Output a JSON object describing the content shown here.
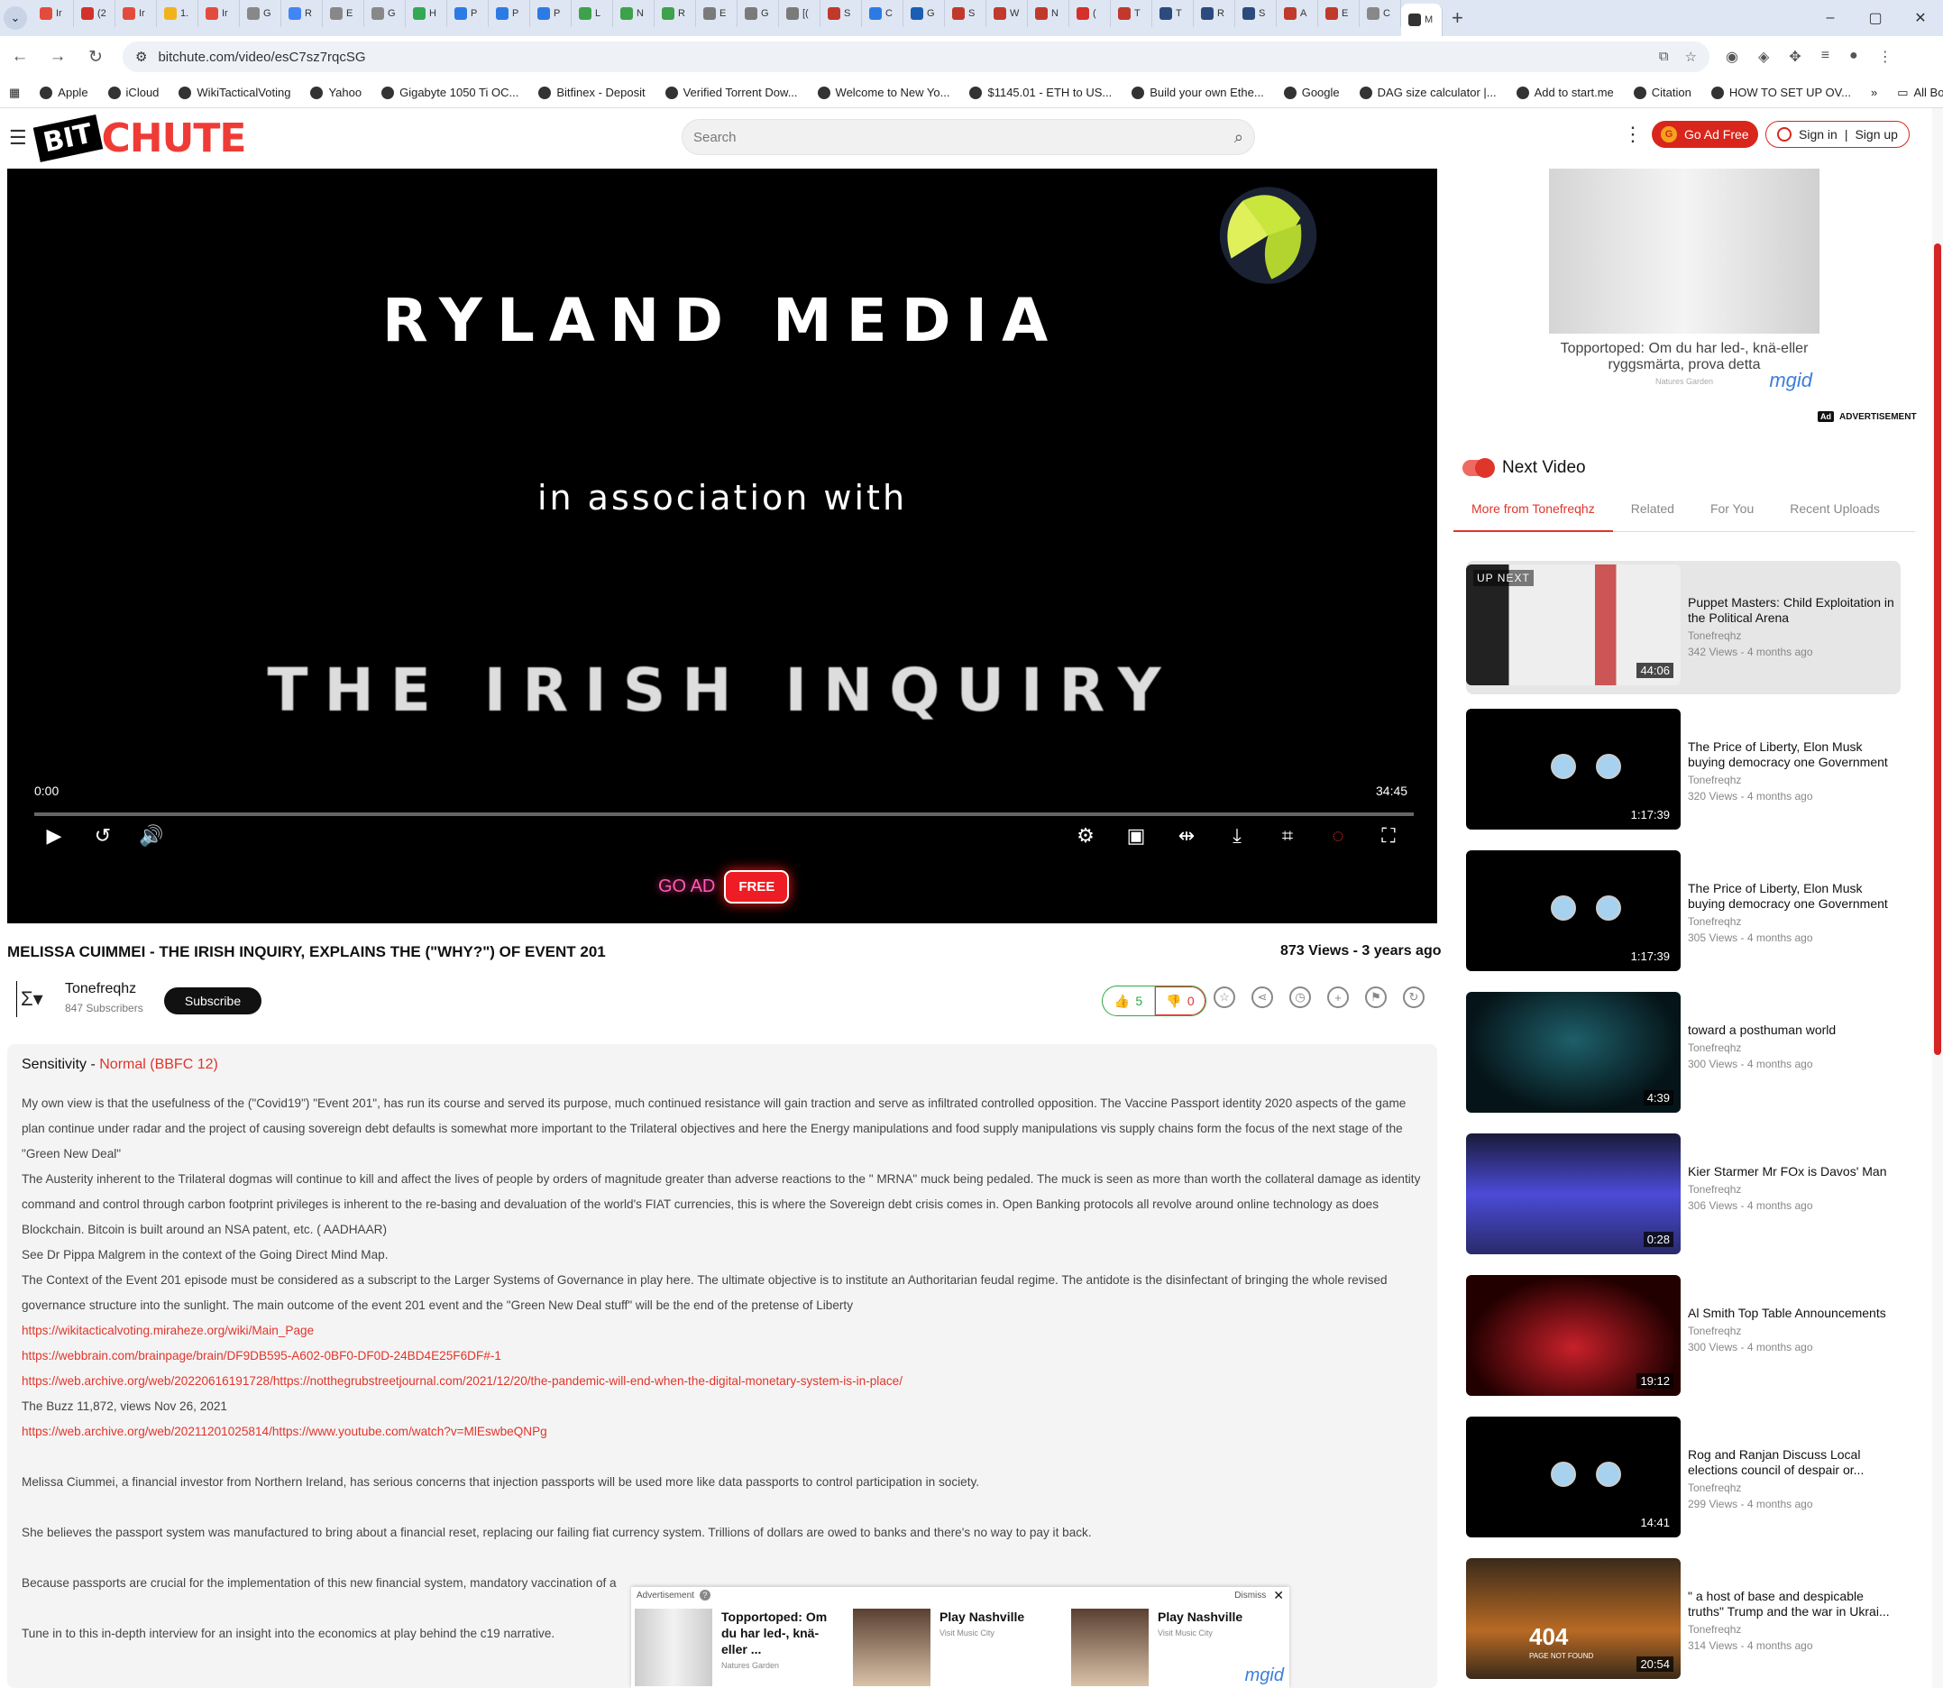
{
  "browser": {
    "tabs": [
      "Ir",
      "(2",
      "Ir",
      "1.",
      "Ir",
      "G",
      "R",
      "E",
      "G",
      "H",
      "P",
      "P",
      "P",
      "L",
      "N",
      "R",
      "E",
      "G",
      "[(",
      "S",
      "C",
      "G",
      "S",
      "W",
      "N",
      "(",
      "T",
      "T",
      "R",
      "S",
      "A",
      "E",
      "C",
      "M"
    ],
    "active_tab_index": 33,
    "url": "bitchute.com/video/esC7sz7rqcSG",
    "bookmarks": [
      "Apple",
      "iCloud",
      "WikiTacticalVoting",
      "Yahoo",
      "Gigabyte 1050 Ti OC...",
      "Bitfinex - Deposit",
      "Verified Torrent Dow...",
      "Welcome to New Yo...",
      "$1145.01 - ETH to US...",
      "Build your own Ethe...",
      "Google",
      "DAG size calculator |...",
      "Add to start.me",
      "Citation",
      "HOW TO SET UP OV..."
    ],
    "all_bookmarks": "All Bookmarks"
  },
  "header": {
    "logo_bit": "BIT",
    "logo_chute": "CHUTE",
    "search_placeholder": "Search",
    "go_ad_free": "Go Ad Free",
    "sign_in": "Sign in",
    "sign_up": "Sign up"
  },
  "player": {
    "line1": "RYLAND MEDIA",
    "line2": "in association with",
    "line3": "THE IRISH INQUIRY",
    "time_current": "0:00",
    "time_duration": "34:45",
    "overlay_go_ad": "GO AD",
    "overlay_free": "FREE"
  },
  "video": {
    "title": "MELISSA CUIMMEI - THE IRISH INQUIRY, EXPLAINS THE (\"WHY?\") OF EVENT 201",
    "views": "873 Views - 3 years ago",
    "channel": "Tonefreqhz",
    "subscribers": "847 Subscribers",
    "subscribe": "Subscribe",
    "likes": "5",
    "dislikes": "0"
  },
  "description": {
    "sensitivity_label": "Sensitivity - ",
    "sensitivity_value": "Normal (BBFC 12)",
    "p1": "My own view is that the usefulness of the (\"Covid19\") \"Event 201\", has run its course and served its purpose, much continued resistance will gain traction and serve as infiltrated controlled opposition. The Vaccine Passport identity 2020 aspects of the game plan continue under radar and the project of causing sovereign debt defaults is somewhat more important to the Trilateral objectives and here the Energy manipulations and food supply manipulations vis supply chains form the focus of the next stage of the \"Green New Deal\"",
    "p2": "The Austerity inherent to the Trilateral dogmas will continue to kill and affect the lives of people by orders of magnitude greater than adverse reactions to the \" MRNA\" muck being pedaled. The muck is seen as more than worth the collateral damage as identity command and control through carbon footprint privileges is inherent to the re-basing and devaluation of the world's FIAT currencies, this is where the Sovereign debt crisis comes in. Open Banking protocols all revolve around online technology as does Blockchain. Bitcoin is built around an NSA patent, etc. ( AADHAAR)",
    "p3": "See Dr Pippa Malgrem in the context of the Going Direct Mind Map.",
    "p4": "The Context of the Event 201 episode must be considered as a subscript to the Larger Systems of Governance in play here. The ultimate objective is to institute an Authoritarian feudal regime. The antidote is the disinfectant of bringing the whole revised governance structure into the sunlight. The main outcome of the event 201 event and the \"Green New Deal stuff\" will be the end of the pretense of Liberty",
    "link1": "https://wikitacticalvoting.miraheze.org/wiki/Main_Page",
    "link2": "https://webbrain.com/brainpage/brain/DF9DB595-A602-0BF0-DF0D-24BD4E25F6DF#-1",
    "link3": "https://web.archive.org/web/20220616191728/https://notthegrubstreetjournal.com/2021/12/20/the-pandemic-will-end-when-the-digital-monetary-system-is-in-place/",
    "p5": "The Buzz 11,872, views Nov 26, 2021",
    "link4": "https://web.archive.org/web/20211201025814/https://www.youtube.com/watch?v=MlEswbeQNPg",
    "p6": "Melissa Ciummei, a financial investor from Northern Ireland, has serious concerns that injection passports will be used more like data passports to control participation in society.",
    "p7": "She believes the passport system was manufactured to bring about a financial reset, replacing our failing fiat currency system. Trillions of dollars are owed to banks and there's no way to pay it back.",
    "p8": "Because passports are crucial for the implementation of this new financial system, mandatory vaccination of a",
    "p9": "Tune in to this in-depth interview for an insight into the economics at play behind the c19 narrative."
  },
  "bottom_ad": {
    "label": "Advertisement",
    "dismiss": "Dismiss",
    "cards": [
      {
        "title": "Topportoped: Om du har led-, knä-eller ...",
        "source": "Natures Garden"
      },
      {
        "title": "Play Nashville",
        "source": "Visit Music City"
      },
      {
        "title": "Play Nashville",
        "source": "Visit Music City"
      }
    ],
    "brand": "mgid"
  },
  "side_ad": {
    "text": "Topportoped: Om du har led-, knä-eller ryggsmärta, prova detta",
    "source": "Natures Garden",
    "brand": "mgid",
    "label": "ADVERTISEMENT",
    "ad_badge": "Ad"
  },
  "sidebar": {
    "next_video": "Next Video",
    "tabs": [
      "More from Tonefreqhz",
      "Related",
      "For You",
      "Recent Uploads"
    ],
    "up_next_label": "UP NEXT",
    "videos": [
      {
        "title": "Puppet Masters: Child Exploitation in the Political Arena",
        "channel": "Tonefreqhz",
        "meta": "342 Views - 4 months ago",
        "duration": "44:06"
      },
      {
        "title": "The Price of Liberty, Elon Musk buying democracy one Government ...",
        "channel": "Tonefreqhz",
        "meta": "320 Views - 4 months ago",
        "duration": "1:17:39"
      },
      {
        "title": "The Price of Liberty, Elon Musk buying democracy one Government ...",
        "channel": "Tonefreqhz",
        "meta": "305 Views - 4 months ago",
        "duration": "1:17:39"
      },
      {
        "title": "toward a posthuman world",
        "channel": "Tonefreqhz",
        "meta": "300 Views - 4 months ago",
        "duration": "4:39"
      },
      {
        "title": "Kier Starmer Mr FOx is Davos' Man",
        "channel": "Tonefreqhz",
        "meta": "306 Views - 4 months ago",
        "duration": "0:28"
      },
      {
        "title": "Al Smith Top Table Announcements",
        "channel": "Tonefreqhz",
        "meta": "300 Views - 4 months ago",
        "duration": "19:12"
      },
      {
        "title": "Rog and Ranjan Discuss Local elections council of despair or...",
        "channel": "Tonefreqhz",
        "meta": "299 Views - 4 months ago",
        "duration": "14:41"
      },
      {
        "title": "\" a host of base and despicable truths\" Trump and the war in Ukrai...",
        "channel": "Tonefreqhz",
        "meta": "314 Views - 4 months ago",
        "duration": "20:54"
      }
    ],
    "thumb_text_404": "404",
    "thumb_text_404_sub": "PAGE NOT FOUND"
  },
  "colors": {
    "brand_red": "#ef3b36",
    "like_green": "#2ea84a",
    "link_red": "#e0352b"
  }
}
